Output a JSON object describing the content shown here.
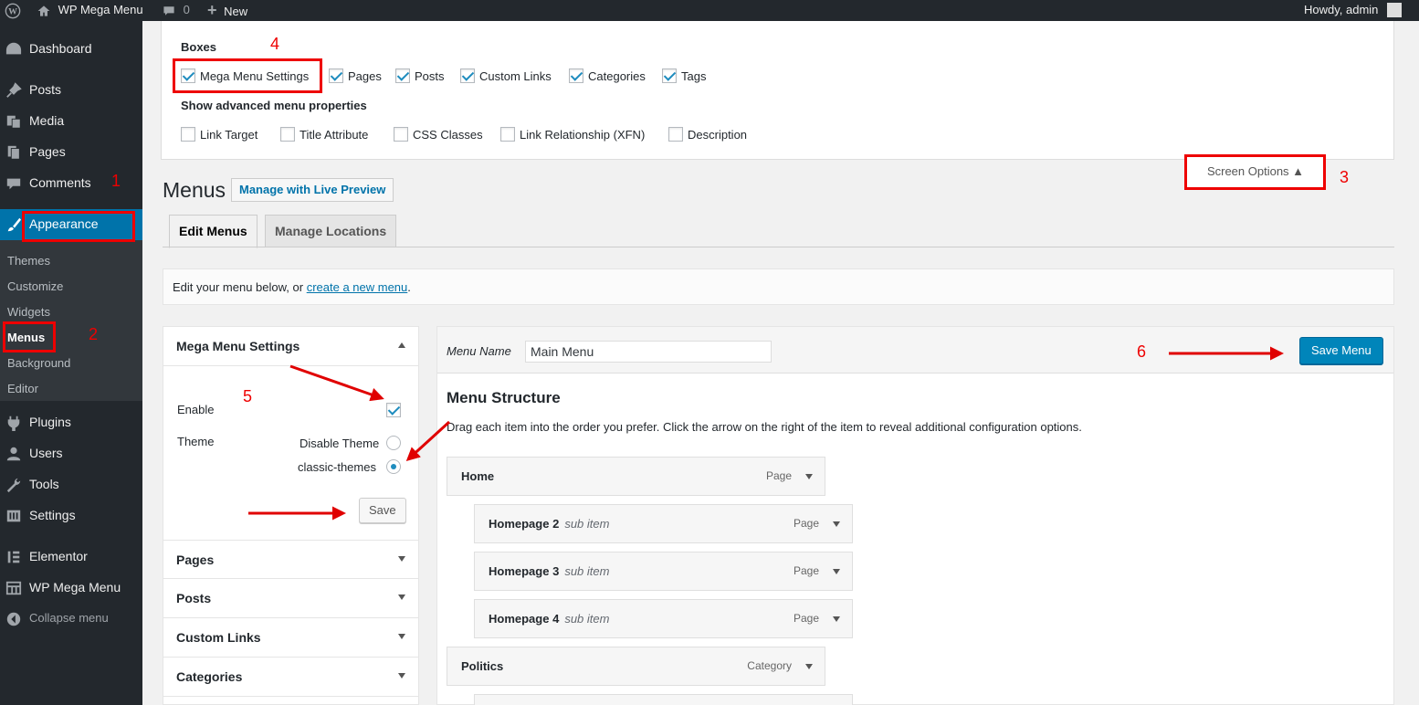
{
  "adminbar": {
    "site_name": "WP Mega Menu",
    "comments_count": "0",
    "new_label": "New",
    "howdy": "Howdy, admin"
  },
  "sidebar": {
    "items": [
      {
        "label": "Dashboard",
        "icon": "dashboard-icon"
      },
      {
        "label": "Posts",
        "icon": "pin-icon"
      },
      {
        "label": "Media",
        "icon": "media-icon"
      },
      {
        "label": "Pages",
        "icon": "pages-icon"
      },
      {
        "label": "Comments",
        "icon": "comment-icon"
      },
      {
        "label": "Appearance",
        "icon": "brush-icon"
      },
      {
        "label": "Plugins",
        "icon": "plug-icon"
      },
      {
        "label": "Users",
        "icon": "user-icon"
      },
      {
        "label": "Tools",
        "icon": "wrench-icon"
      },
      {
        "label": "Settings",
        "icon": "settings-icon"
      },
      {
        "label": "Elementor",
        "icon": "elementor-icon"
      },
      {
        "label": "WP Mega Menu",
        "icon": "grid-icon"
      },
      {
        "label": "Collapse menu",
        "icon": "collapse-icon"
      }
    ],
    "appearance_submenu": [
      "Themes",
      "Customize",
      "Widgets",
      "Menus",
      "Background",
      "Editor"
    ]
  },
  "screen_options": {
    "boxes_heading": "Boxes",
    "boxes": [
      {
        "label": "Mega Menu Settings",
        "checked": true
      },
      {
        "label": "Pages",
        "checked": true
      },
      {
        "label": "Posts",
        "checked": true
      },
      {
        "label": "Custom Links",
        "checked": true
      },
      {
        "label": "Categories",
        "checked": true
      },
      {
        "label": "Tags",
        "checked": true
      }
    ],
    "advanced_heading": "Show advanced menu properties",
    "advanced": [
      {
        "label": "Link Target",
        "checked": false
      },
      {
        "label": "Title Attribute",
        "checked": false
      },
      {
        "label": "CSS Classes",
        "checked": false
      },
      {
        "label": "Link Relationship (XFN)",
        "checked": false
      },
      {
        "label": "Description",
        "checked": false
      }
    ],
    "toggle_label": "Screen Options ▲"
  },
  "page": {
    "title": "Menus",
    "live_preview": "Manage with Live Preview",
    "tabs": [
      "Edit Menus",
      "Manage Locations"
    ],
    "edit_prefix": "Edit your menu below, or ",
    "create_link": "create a new menu",
    "edit_suffix": "."
  },
  "mega_menu_settings": {
    "title": "Mega Menu Settings",
    "enable_label": "Enable",
    "enable_checked": true,
    "theme_label": "Theme",
    "theme_options": [
      {
        "label": "Disable Theme",
        "checked": false
      },
      {
        "label": "classic-themes",
        "checked": true
      }
    ],
    "save_label": "Save"
  },
  "accordion_sections": [
    "Pages",
    "Posts",
    "Custom Links",
    "Categories"
  ],
  "menu_editor": {
    "name_label": "Menu Name",
    "name_value": "Main Menu",
    "save_label": "Save Menu",
    "structure_title": "Menu Structure",
    "instructions": "Drag each item into the order you prefer. Click the arrow on the right of the item to reveal additional configuration options.",
    "items": [
      {
        "title": "Home",
        "sub": "",
        "type": "Page",
        "depth": 0
      },
      {
        "title": "Homepage 2",
        "sub": "sub item",
        "type": "Page",
        "depth": 1
      },
      {
        "title": "Homepage 3",
        "sub": "sub item",
        "type": "Page",
        "depth": 1
      },
      {
        "title": "Homepage 4",
        "sub": "sub item",
        "type": "Page",
        "depth": 1
      },
      {
        "title": "Politics",
        "sub": "",
        "type": "Category",
        "depth": 0
      }
    ]
  },
  "annotations": [
    "1",
    "2",
    "3",
    "4",
    "5",
    "6"
  ],
  "colors": {
    "accent": "#0073aa",
    "annotation": "#e00000",
    "adminbar": "#23282d"
  }
}
